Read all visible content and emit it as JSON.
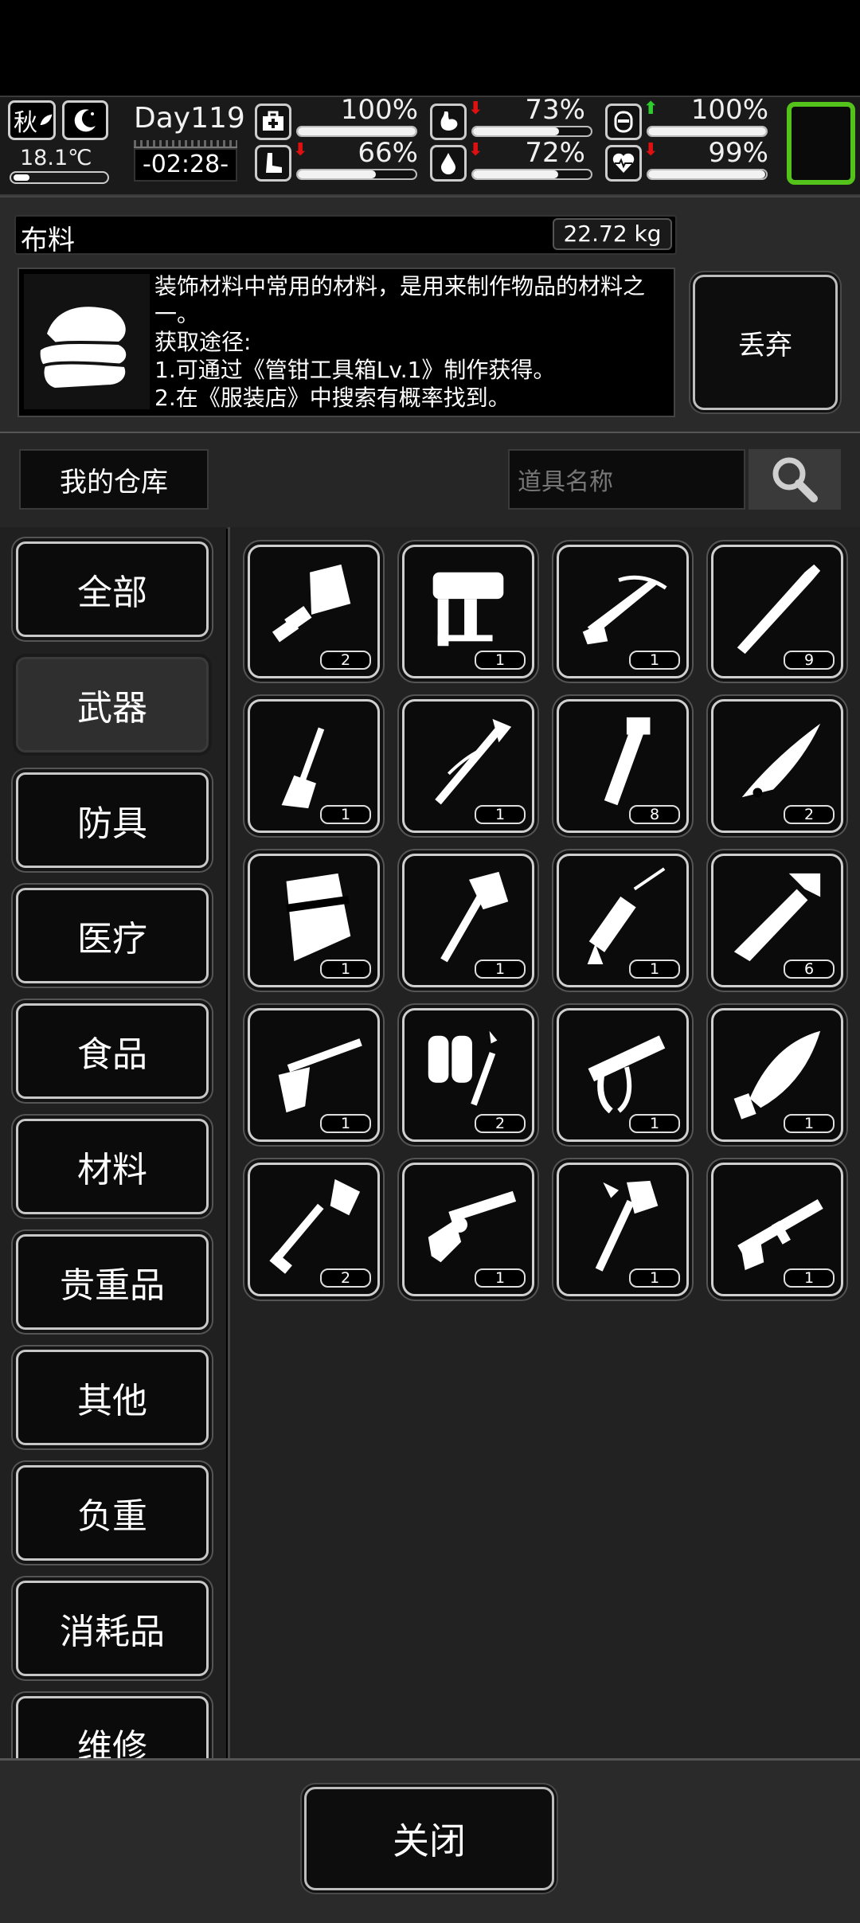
{
  "status": {
    "season": "秋",
    "temperature": "18.1℃",
    "day": "Day119",
    "time": "-02:28-",
    "stats": [
      {
        "icon": "medkit-icon",
        "percent": "100%",
        "level": 1.0,
        "trend": "none"
      },
      {
        "icon": "stomach-icon",
        "percent": "73%",
        "level": 0.73,
        "trend": "down"
      },
      {
        "icon": "bladder-icon",
        "percent": "100%",
        "level": 1.0,
        "trend": "up"
      },
      {
        "icon": "foot-icon",
        "percent": "66%",
        "level": 0.66,
        "trend": "down"
      },
      {
        "icon": "water-drop-icon",
        "percent": "72%",
        "level": 0.72,
        "trend": "down"
      },
      {
        "icon": "heart-icon",
        "percent": "99%",
        "level": 0.99,
        "trend": "down"
      }
    ],
    "colors": {
      "down_arrow": "#e01010",
      "up_arrow": "#2ecc2e",
      "frame": "#53c31b"
    }
  },
  "item_info": {
    "name": "布料",
    "weight": "22.72 kg",
    "icon": "cloth-icon",
    "description": "装饰材料中常用的材料，是用来制作物品的材料之一。\n获取途径:\n1.可通过《管钳工具箱Lv.1》制作获得。\n2.在《服装店》中搜索有概率找到。",
    "discard_label": "丢弃"
  },
  "warehouse": {
    "title": "我的仓库",
    "search_placeholder": "道具名称"
  },
  "categories": [
    {
      "label": "全部",
      "active": false
    },
    {
      "label": "武器",
      "active": true
    },
    {
      "label": "防具",
      "active": false
    },
    {
      "label": "医疗",
      "active": false
    },
    {
      "label": "食品",
      "active": false
    },
    {
      "label": "材料",
      "active": false
    },
    {
      "label": "贵重品",
      "active": false
    },
    {
      "label": "其他",
      "active": false
    },
    {
      "label": "负重",
      "active": false
    },
    {
      "label": "消耗品",
      "active": false
    },
    {
      "label": "维修",
      "active": false
    }
  ],
  "items": [
    {
      "icon": "cleaver-icon",
      "qty": "2"
    },
    {
      "icon": "nail-gun-icon",
      "qty": "1"
    },
    {
      "icon": "crossbow-icon",
      "qty": "1"
    },
    {
      "icon": "wooden-club-icon",
      "qty": "9"
    },
    {
      "icon": "scraper-icon",
      "qty": "1"
    },
    {
      "icon": "wired-spear-icon",
      "qty": "1"
    },
    {
      "icon": "pipe-wrench-club-icon",
      "qty": "8"
    },
    {
      "icon": "folding-knife-icon",
      "qty": "2"
    },
    {
      "icon": "riot-shield-icon",
      "qty": "1"
    },
    {
      "icon": "axe-icon",
      "qty": "1"
    },
    {
      "icon": "caulking-gun-icon",
      "qty": "1"
    },
    {
      "icon": "hacksaw-machete-icon",
      "qty": "6"
    },
    {
      "icon": "shotgun-icon",
      "qty": "1"
    },
    {
      "icon": "flamethrower-icon",
      "qty": "2"
    },
    {
      "icon": "staple-gun-icon",
      "qty": "1"
    },
    {
      "icon": "kukri-icon",
      "qty": "1"
    },
    {
      "icon": "shovel-icon",
      "qty": "2"
    },
    {
      "icon": "revolver-icon",
      "qty": "1"
    },
    {
      "icon": "fire-axe-icon",
      "qty": "1"
    },
    {
      "icon": "assault-rifle-icon",
      "qty": "1"
    }
  ],
  "footer": {
    "close_label": "关闭"
  }
}
